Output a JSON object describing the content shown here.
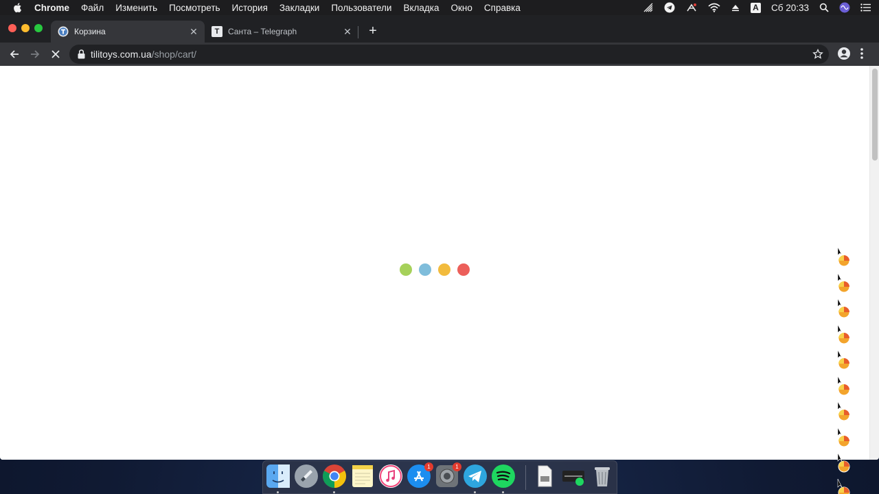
{
  "menubar": {
    "app_name": "Chrome",
    "items": [
      "Файл",
      "Изменить",
      "Посмотреть",
      "История",
      "Закладки",
      "Пользователи",
      "Вкладка",
      "Окно",
      "Справка"
    ],
    "input_source": "A",
    "clock": "Сб 20:33"
  },
  "tabs": [
    {
      "title": "Корзина",
      "active": true
    },
    {
      "title": "Санта – Telegraph",
      "active": false,
      "favicon_letter": "T"
    }
  ],
  "omnibox": {
    "host": "tilitoys.com.ua",
    "path": "/shop/cart/"
  },
  "page": {
    "loader_colors": [
      "#a6d15a",
      "#7fbddb",
      "#f2bb3d",
      "#ec5f5a"
    ]
  },
  "dock": {
    "apps": [
      {
        "name": "Finder",
        "running": true
      },
      {
        "name": "Launchpad",
        "running": false
      },
      {
        "name": "Google Chrome",
        "running": true
      },
      {
        "name": "Notes",
        "running": false
      },
      {
        "name": "iTunes",
        "running": false
      },
      {
        "name": "App Store",
        "running": false,
        "badge": "1"
      },
      {
        "name": "System Preferences",
        "running": false,
        "badge": "1"
      },
      {
        "name": "Telegram",
        "running": true
      },
      {
        "name": "Spotify",
        "running": true
      }
    ],
    "badges": {
      "app_store": "1",
      "system_preferences": "1"
    }
  },
  "colors": {
    "menubar_bg": "#1d1d1f",
    "tabstrip_bg": "#202124",
    "toolbar_bg": "#35363a"
  }
}
